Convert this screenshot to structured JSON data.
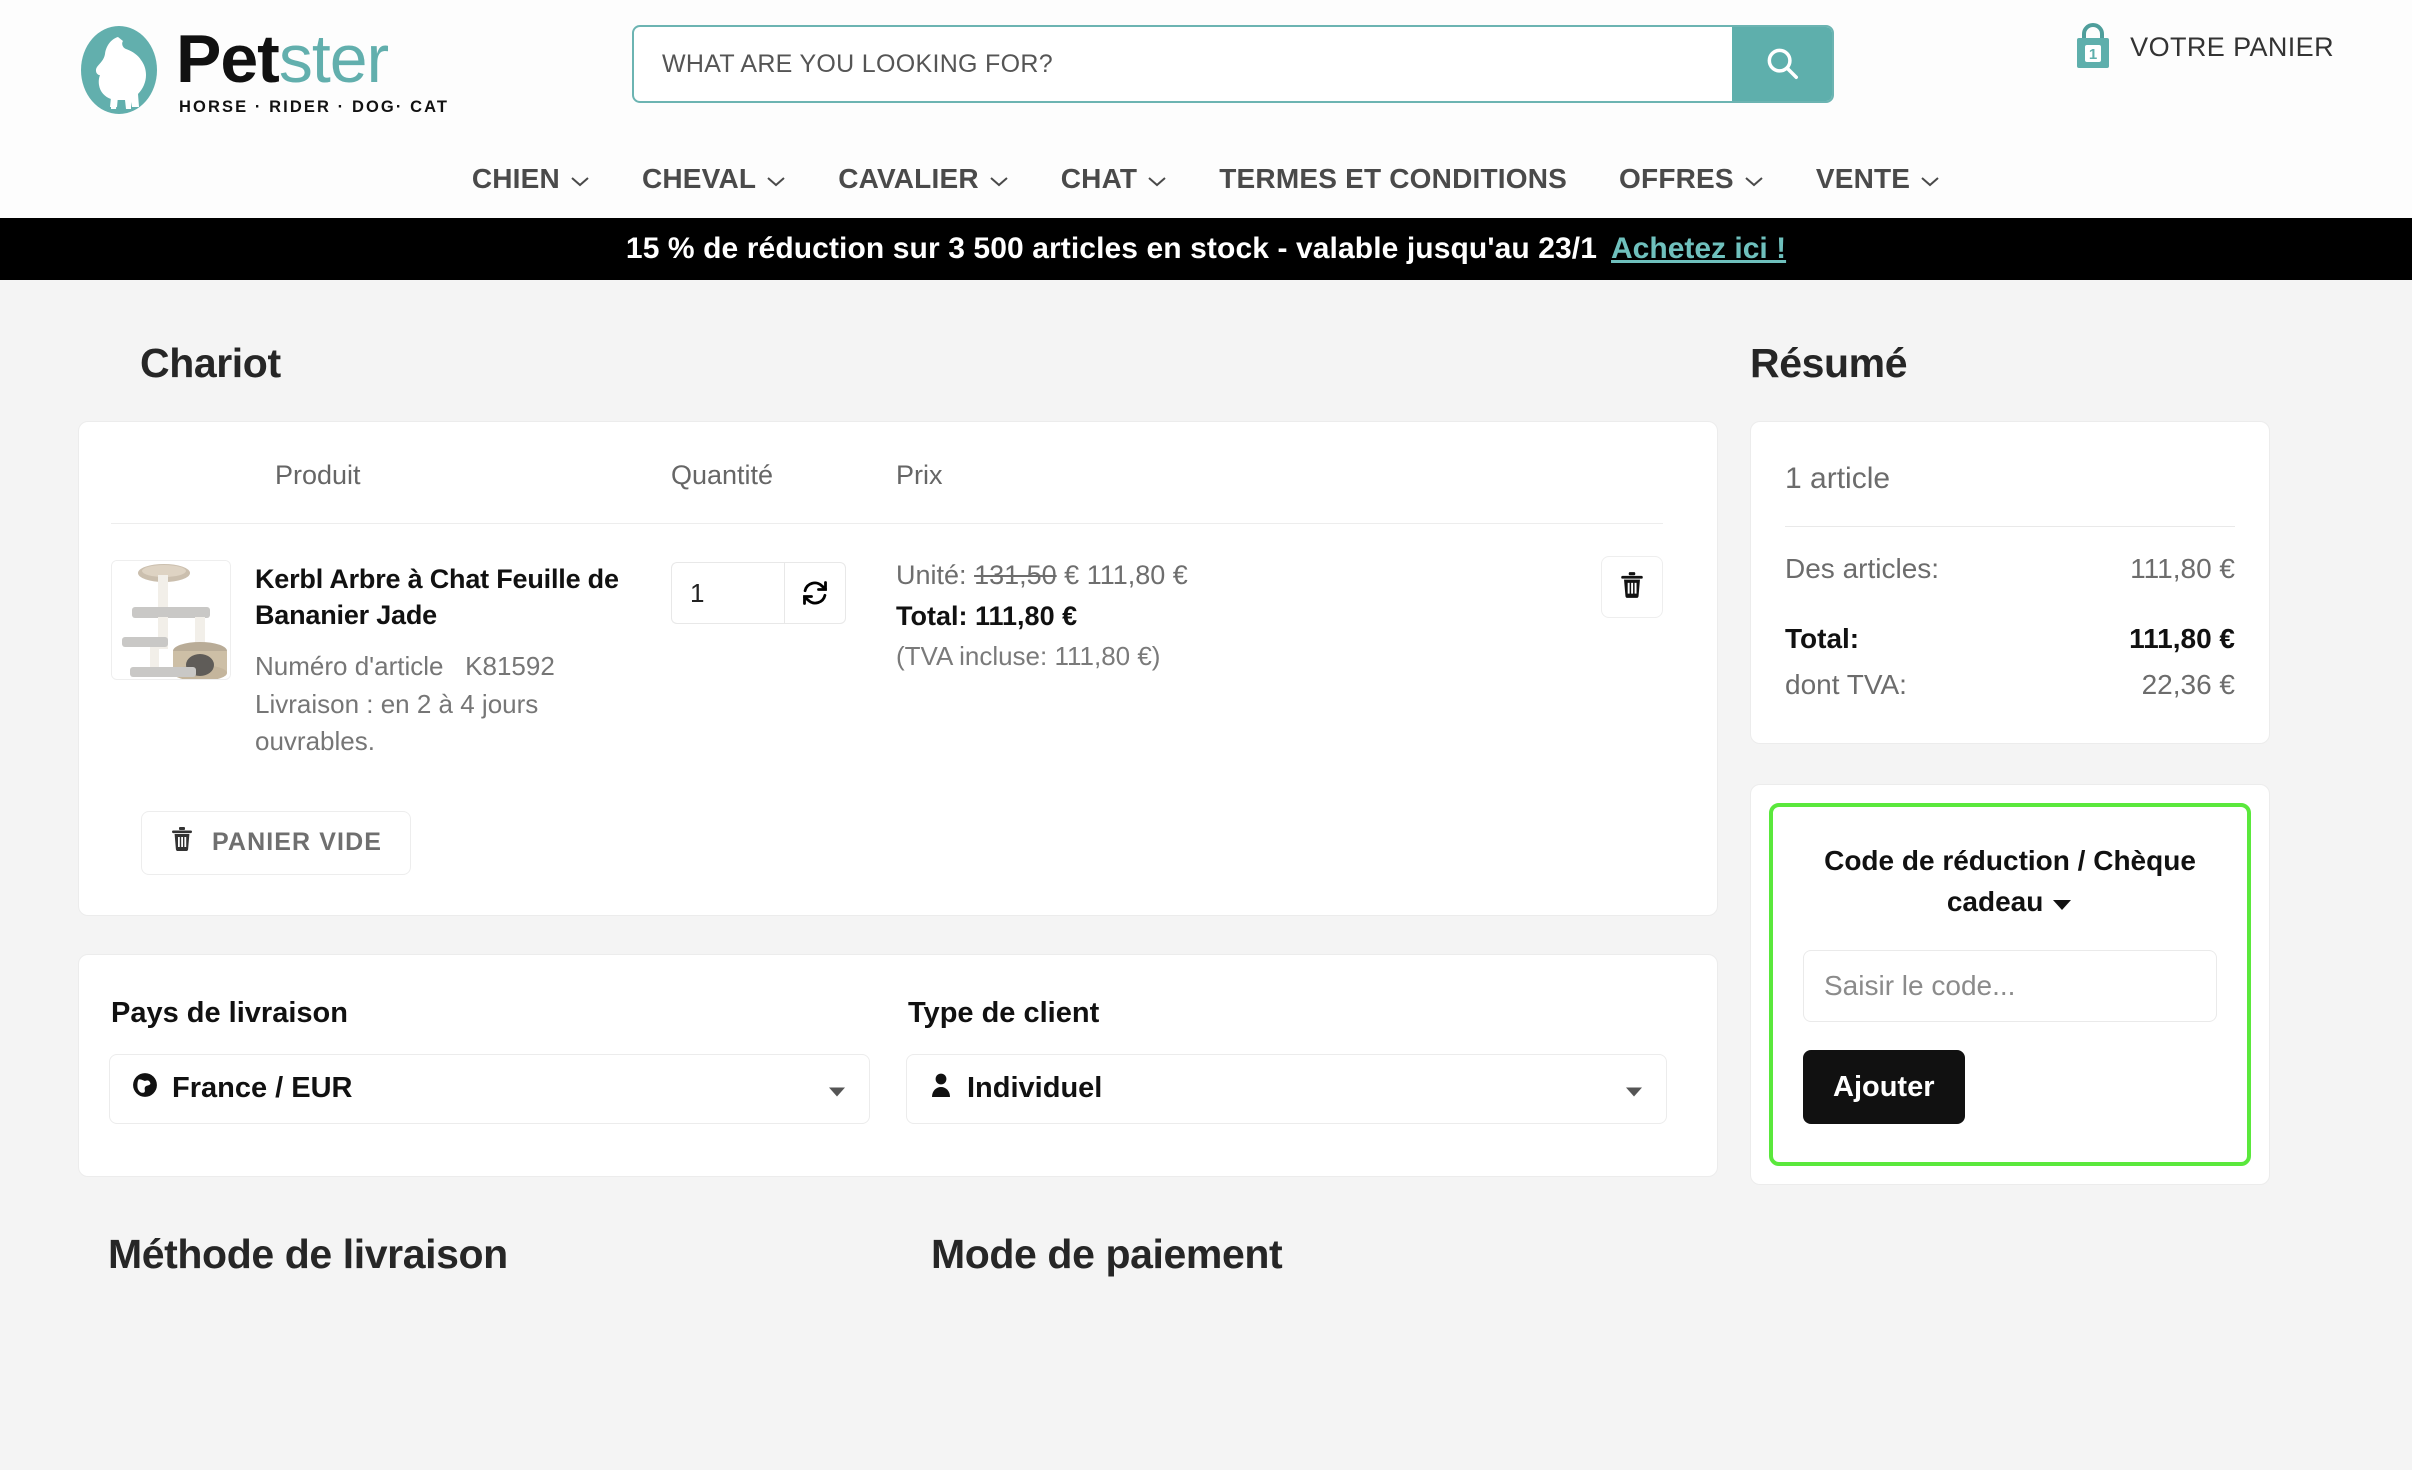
{
  "brand": {
    "name_part1": "Pet",
    "name_part2": "ster",
    "tagline": "HORSE · RIDER · DOG· CAT",
    "accent_color": "#62afad",
    "logo_icon": "horse-dog-cat-circle-icon"
  },
  "search": {
    "placeholder": "WHAT ARE YOU LOOKING FOR?",
    "value": "",
    "button_icon": "search-icon"
  },
  "cart_link": {
    "label": "VOTRE PANIER",
    "icon": "shopping-bag-icon",
    "count": "1"
  },
  "nav": {
    "items": [
      {
        "label": "CHIEN",
        "has_caret": true
      },
      {
        "label": "CHEVAL",
        "has_caret": true
      },
      {
        "label": "CAVALIER",
        "has_caret": true
      },
      {
        "label": "CHAT",
        "has_caret": true
      },
      {
        "label": "TERMES ET CONDITIONS",
        "has_caret": false
      },
      {
        "label": "OFFRES",
        "has_caret": true
      },
      {
        "label": "VENTE",
        "has_caret": true
      }
    ]
  },
  "promo": {
    "text": "15 % de réduction sur 3 500 articles en stock - valable jusqu'au 23/1",
    "link": "Achetez ici !",
    "link_color": "#6fc0bd",
    "background": "#000000"
  },
  "cart": {
    "title": "Chariot",
    "columns": {
      "product": "Produit",
      "quantity": "Quantité",
      "price": "Prix"
    },
    "items": [
      {
        "name": "Kerbl Arbre à Chat Feuille de Bananier Jade",
        "article_label": "Numéro d'article",
        "article_number": "K81592",
        "delivery": "Livraison : en 2 à 4 jours ouvrables.",
        "quantity": "1",
        "refresh_icon": "refresh-icon",
        "unit_label": "Unité:",
        "unit_price_old": "131,50",
        "unit_price_old_currency": "€",
        "unit_price_new": "111,80 €",
        "total_label": "Total: 111,80 €",
        "vat_note": "(TVA incluse: 111,80 €)",
        "delete_icon": "trash-icon",
        "thumbnail": "cat-tree-photo"
      }
    ],
    "empty_button": {
      "label": "PANIER VIDE",
      "icon": "trash-icon"
    }
  },
  "options": {
    "country": {
      "label": "Pays de livraison",
      "value": "France / EUR",
      "icon": "globe-icon",
      "caret": "chevron-down-icon"
    },
    "customer_type": {
      "label": "Type de client",
      "value": "Individuel",
      "icon": "person-icon",
      "caret": "chevron-down-icon"
    }
  },
  "bottom_sections": {
    "shipping_method": "Méthode de livraison",
    "payment_method": "Mode de paiement"
  },
  "summary": {
    "title": "Résumé",
    "item_count": "1 article",
    "rows": [
      {
        "label": "Des articles:",
        "value": "111,80 €",
        "bold": false
      },
      {
        "label": "Total:",
        "value": "111,80 €",
        "bold": true
      },
      {
        "label": "dont TVA:",
        "value": "22,36 €",
        "bold": false
      }
    ]
  },
  "discount": {
    "title": "Code de réduction / Chèque cadeau",
    "caret": "caret-down-icon",
    "input_placeholder": "Saisir le code...",
    "input_value": "",
    "button_label": "Ajouter",
    "highlight_color": "#5ae83c"
  }
}
